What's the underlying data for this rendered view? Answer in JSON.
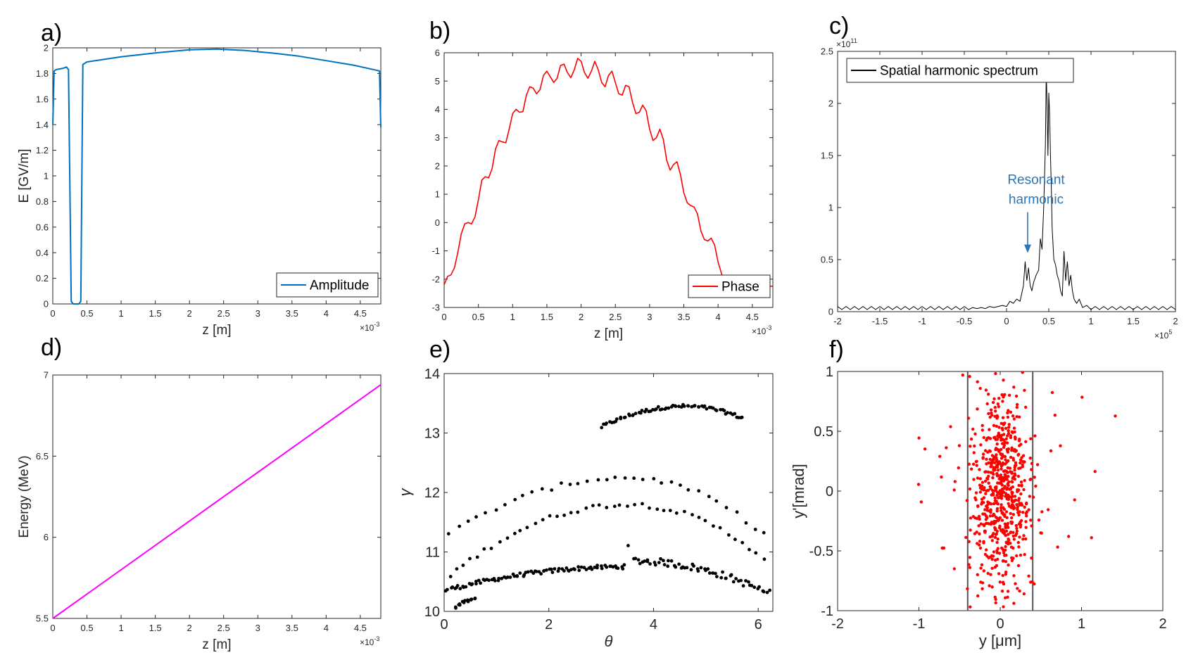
{
  "colors": {
    "amplitude": "#0072BD",
    "phase": "#FF0000",
    "spectrum": "#000000",
    "energy": "#FF00FF",
    "gamma_points": "#000000",
    "transverse_points": "#FF0000",
    "annotation": "#2E75B6",
    "axes": "#262626"
  },
  "chart_data": [
    {
      "id": "a",
      "panel_label": "a)",
      "type": "line",
      "xlabel": "z [m]",
      "ylabel": "E [GV/m]",
      "x_exponent": "×10",
      "x_exponent_power": "-3",
      "xlim": [
        0,
        4.8
      ],
      "ylim": [
        0,
        2
      ],
      "xticks": [
        0,
        0.5,
        1,
        1.5,
        2,
        2.5,
        3,
        3.5,
        4,
        4.5
      ],
      "yticks": [
        0,
        0.2,
        0.4,
        0.6,
        0.8,
        1,
        1.2,
        1.4,
        1.6,
        1.8,
        2
      ],
      "legend": "bottom-right",
      "series": [
        {
          "name": "Amplitude",
          "x": [
            0,
            0.02,
            0.05,
            0.15,
            0.2,
            0.23,
            0.27,
            0.3,
            0.38,
            0.41,
            0.44,
            0.5,
            1.0,
            1.5,
            2.0,
            2.4,
            2.8,
            3.2,
            3.6,
            4.0,
            4.4,
            4.78,
            4.8
          ],
          "y": [
            1.4,
            1.82,
            1.83,
            1.84,
            1.85,
            1.83,
            0.02,
            0.0,
            0.0,
            0.02,
            1.87,
            1.89,
            1.93,
            1.96,
            1.985,
            1.99,
            1.98,
            1.96,
            1.935,
            1.9,
            1.865,
            1.82,
            1.38
          ]
        }
      ]
    },
    {
      "id": "b",
      "panel_label": "b)",
      "type": "line",
      "xlabel": "z [m]",
      "ylabel": "",
      "x_exponent": "×10",
      "x_exponent_power": "-3",
      "xlim": [
        0,
        4.8
      ],
      "ylim": [
        -3,
        6
      ],
      "xticks": [
        0,
        0.5,
        1,
        1.5,
        2,
        2.5,
        3,
        3.5,
        4,
        4.5
      ],
      "yticks": [
        -3,
        -2,
        -1,
        0,
        1,
        2,
        3,
        4,
        5,
        6
      ],
      "legend": "bottom-right",
      "series": [
        {
          "name": "Phase",
          "x": [
            0,
            0.05,
            0.1,
            0.15,
            0.2,
            0.25,
            0.3,
            0.35,
            0.4,
            0.45,
            0.5,
            0.55,
            0.6,
            0.65,
            0.7,
            0.75,
            0.8,
            0.85,
            0.9,
            0.95,
            1.0,
            1.05,
            1.1,
            1.15,
            1.2,
            1.25,
            1.3,
            1.35,
            1.4,
            1.45,
            1.5,
            1.55,
            1.6,
            1.65,
            1.7,
            1.75,
            1.8,
            1.85,
            1.9,
            1.95,
            2.0,
            2.05,
            2.1,
            2.15,
            2.2,
            2.25,
            2.3,
            2.35,
            2.4,
            2.45,
            2.5,
            2.55,
            2.6,
            2.65,
            2.7,
            2.75,
            2.8,
            2.85,
            2.9,
            2.95,
            3.0,
            3.05,
            3.1,
            3.15,
            3.2,
            3.25,
            3.3,
            3.35,
            3.4,
            3.45,
            3.5,
            3.55,
            3.6,
            3.65,
            3.7,
            3.75,
            3.8,
            3.85,
            3.9,
            3.95,
            4.0,
            4.05,
            4.1,
            4.15,
            4.2,
            4.25,
            4.3,
            4.35,
            4.4,
            4.45,
            4.5,
            4.55,
            4.6,
            4.65,
            4.7,
            4.75,
            4.8
          ],
          "y": [
            -2.2,
            -1.9,
            -1.85,
            -1.6,
            -1.05,
            -0.4,
            -0.05,
            0.0,
            -0.05,
            0.2,
            0.8,
            1.5,
            1.62,
            1.58,
            1.9,
            2.6,
            2.9,
            2.85,
            2.82,
            3.3,
            3.85,
            4.0,
            3.9,
            3.92,
            4.5,
            4.8,
            4.75,
            4.55,
            4.7,
            5.2,
            5.35,
            5.15,
            4.95,
            5.1,
            5.55,
            5.6,
            5.3,
            5.12,
            5.4,
            5.8,
            5.7,
            5.3,
            5.1,
            5.35,
            5.7,
            5.4,
            4.95,
            4.8,
            5.2,
            5.35,
            4.95,
            4.55,
            4.5,
            4.85,
            4.8,
            4.25,
            3.85,
            3.9,
            4.15,
            3.95,
            3.3,
            2.9,
            3.0,
            3.3,
            2.95,
            2.2,
            1.85,
            2.05,
            2.15,
            1.7,
            1.05,
            0.7,
            0.6,
            0.55,
            0.3,
            -0.3,
            -0.6,
            -0.65,
            -0.55,
            -0.8,
            -1.4,
            -1.8,
            -2.2,
            -2.25,
            -2.25,
            -2.25,
            -2.25,
            -2.25,
            -2.25,
            -2.25,
            -2.25,
            -2.25,
            -2.25,
            -2.25,
            -2.25,
            -2.25,
            -2.25
          ]
        }
      ]
    },
    {
      "id": "c",
      "panel_label": "c)",
      "type": "line",
      "xlabel": "",
      "ylabel": "",
      "x_exponent": "×10",
      "x_exponent_power": "5",
      "y_exponent": "×10",
      "y_exponent_power": "11",
      "xlim": [
        -2,
        2
      ],
      "ylim": [
        0,
        2.5
      ],
      "xticks": [
        -2,
        -1.5,
        -1,
        -0.5,
        0,
        0.5,
        1,
        1.5,
        2
      ],
      "yticks": [
        0,
        0.5,
        1,
        1.5,
        2,
        2.5
      ],
      "legend": "top-left",
      "annotation": {
        "text_line1": "Resonant",
        "text_line2": "harmonic",
        "arrow_x": 0.25,
        "arrow_y": 0.55
      },
      "series": [
        {
          "name": "Spatial harmonic spectrum",
          "x": [
            -2.0,
            -1.95,
            -1.9,
            -1.85,
            -1.8,
            -1.75,
            -1.7,
            -1.65,
            -1.6,
            -1.55,
            -1.5,
            -1.45,
            -1.4,
            -1.35,
            -1.3,
            -1.25,
            -1.2,
            -1.15,
            -1.1,
            -1.05,
            -1.0,
            -0.95,
            -0.9,
            -0.85,
            -0.8,
            -0.75,
            -0.7,
            -0.65,
            -0.6,
            -0.55,
            -0.5,
            -0.45,
            -0.4,
            -0.35,
            -0.3,
            -0.25,
            -0.2,
            -0.15,
            -0.1,
            -0.05,
            0.0,
            0.04,
            0.08,
            0.12,
            0.16,
            0.2,
            0.22,
            0.24,
            0.26,
            0.28,
            0.3,
            0.32,
            0.35,
            0.38,
            0.4,
            0.42,
            0.44,
            0.46,
            0.47,
            0.48,
            0.49,
            0.5,
            0.51,
            0.52,
            0.53,
            0.54,
            0.56,
            0.58,
            0.6,
            0.62,
            0.64,
            0.66,
            0.68,
            0.7,
            0.72,
            0.74,
            0.76,
            0.78,
            0.8,
            0.83,
            0.86,
            0.9,
            0.95,
            1.0,
            1.05,
            1.1,
            1.15,
            1.2,
            1.25,
            1.3,
            1.35,
            1.4,
            1.45,
            1.5,
            1.55,
            1.6,
            1.65,
            1.7,
            1.75,
            1.8,
            1.85,
            1.9,
            1.95,
            2.0
          ],
          "y": [
            0.05,
            0.02,
            0.05,
            0.02,
            0.05,
            0.02,
            0.05,
            0.02,
            0.05,
            0.02,
            0.05,
            0.02,
            0.05,
            0.02,
            0.05,
            0.02,
            0.05,
            0.02,
            0.05,
            0.02,
            0.05,
            0.02,
            0.05,
            0.02,
            0.05,
            0.02,
            0.05,
            0.02,
            0.05,
            0.02,
            0.05,
            0.02,
            0.04,
            0.03,
            0.04,
            0.03,
            0.05,
            0.04,
            0.05,
            0.06,
            0.05,
            0.1,
            0.08,
            0.12,
            0.1,
            0.25,
            0.48,
            0.3,
            0.42,
            0.25,
            0.2,
            0.28,
            0.35,
            0.4,
            0.7,
            0.6,
            1.0,
            1.6,
            2.3,
            2.0,
            1.5,
            2.1,
            1.9,
            1.5,
            1.2,
            0.8,
            0.5,
            0.45,
            0.35,
            0.3,
            0.2,
            0.15,
            0.58,
            0.3,
            0.48,
            0.25,
            0.35,
            0.2,
            0.12,
            0.08,
            0.12,
            0.04,
            0.06,
            0.02,
            0.05,
            0.02,
            0.05,
            0.02,
            0.05,
            0.02,
            0.05,
            0.02,
            0.05,
            0.02,
            0.05,
            0.02,
            0.05,
            0.02,
            0.05,
            0.02,
            0.05,
            0.02,
            0.05,
            0.02
          ]
        }
      ]
    },
    {
      "id": "d",
      "panel_label": "d)",
      "type": "line",
      "xlabel": "z [m]",
      "ylabel": "Energy (MeV)",
      "x_exponent": "×10",
      "x_exponent_power": "-3",
      "xlim": [
        0,
        4.8
      ],
      "ylim": [
        5.5,
        7
      ],
      "xticks": [
        0,
        0.5,
        1,
        1.5,
        2,
        2.5,
        3,
        3.5,
        4,
        4.5
      ],
      "yticks": [
        5.5,
        6,
        6.5,
        7
      ],
      "series": [
        {
          "name": "",
          "x": [
            0,
            4.8
          ],
          "y": [
            5.5,
            6.94
          ]
        }
      ]
    },
    {
      "id": "e",
      "panel_label": "e)",
      "type": "scatter",
      "xlabel": "θ",
      "ylabel": "γ",
      "xlim": [
        0,
        6.28
      ],
      "ylim": [
        10,
        14
      ],
      "xticks": [
        0,
        2,
        4,
        6
      ],
      "yticks": [
        10,
        11,
        12,
        13,
        14
      ],
      "bands": [
        {
          "name": "",
          "x_start": 3.0,
          "x_end": 5.7,
          "points": 70,
          "y_start": 13.1,
          "y_mid": 13.45,
          "y_end": 13.25,
          "peak_x": 4.6,
          "spread": 0.06
        },
        {
          "name": "",
          "x_start": 0.0,
          "x_end": 3.5,
          "points": 90,
          "y_start": 10.35,
          "y_mid": 10.75,
          "y_end": 11.1,
          "peak_x": 3.5,
          "spread": 0.07
        },
        {
          "name": "",
          "x_start": 3.6,
          "x_end": 6.2,
          "points": 60,
          "y_start": 11.25,
          "y_mid": 10.85,
          "y_end": 10.3,
          "peak_x": 3.6,
          "spread": 0.12
        },
        {
          "name": "",
          "x_start": 0.1,
          "x_end": 6.1,
          "points": 45,
          "y_start": 10.6,
          "y_mid": 11.8,
          "y_end": 10.9,
          "peak_x": 3.5,
          "spread": 0.08
        },
        {
          "name": "",
          "x_start": 0.1,
          "x_end": 6.1,
          "points": 35,
          "y_start": 11.3,
          "y_mid": 12.25,
          "y_end": 11.3,
          "peak_x": 3.5,
          "spread": 0.08
        },
        {
          "name": "",
          "x_start": 0.2,
          "x_end": 0.6,
          "points": 15,
          "y_start": 10.05,
          "y_mid": 10.2,
          "y_end": 10.45,
          "peak_x": 0.6,
          "spread": 0.05
        }
      ]
    },
    {
      "id": "f",
      "panel_label": "f)",
      "type": "scatter",
      "xlabel": "y [μm]",
      "ylabel": "y'[mrad]",
      "xlim": [
        -2,
        2
      ],
      "ylim": [
        -1,
        1
      ],
      "xticks": [
        -2,
        -1,
        0,
        1,
        2
      ],
      "yticks": [
        -1,
        -0.5,
        0,
        0.5,
        1
      ],
      "vertical_lines": [
        -0.4,
        0.4
      ],
      "points_count": 700,
      "sigma_y": 0.18,
      "sigma_yp": 0.42
    }
  ]
}
